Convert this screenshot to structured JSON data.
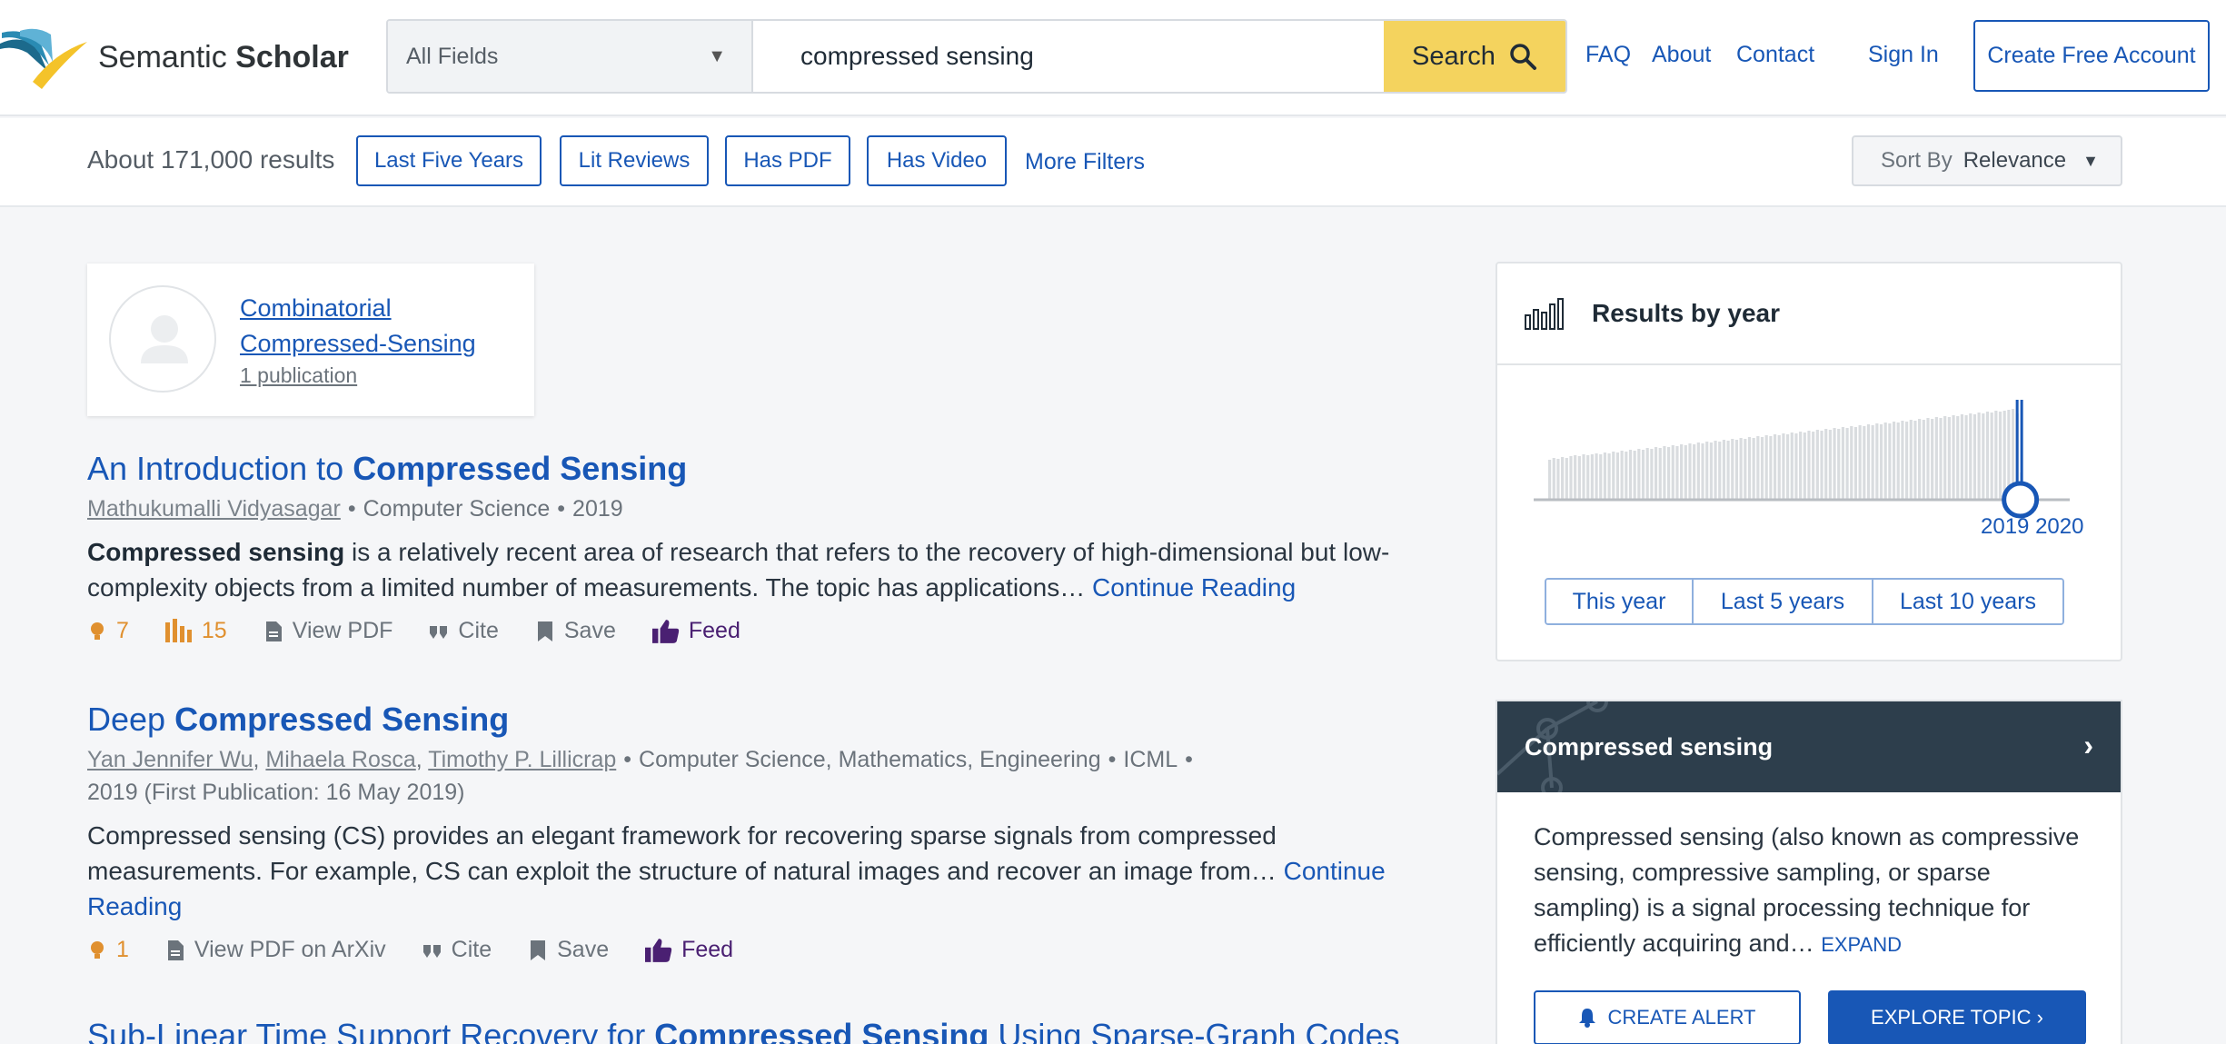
{
  "header": {
    "brand_word1": "Semantic",
    "brand_word2": "Scholar",
    "field_select": "All Fields",
    "query": "compressed sensing",
    "search_label": "Search",
    "nav": [
      "FAQ",
      "About",
      "Contact",
      "Sign In"
    ],
    "create_account": "Create Free Account"
  },
  "filters": {
    "result_count": "About 171,000 results",
    "chips": [
      "Last Five Years",
      "Lit Reviews",
      "Has PDF",
      "Has Video"
    ],
    "more_filters": "More Filters",
    "sort_label": "Sort By",
    "sort_value": "Relevance"
  },
  "author_card": {
    "name": "Combinatorial Compressed-Sensing",
    "publications": "1 publication"
  },
  "results": [
    {
      "title_plain": "An Introduction to ",
      "title_bold": "Compressed Sensing",
      "title_after": "",
      "authors": [
        "Mathukumalli Vidyasagar"
      ],
      "fields": "Computer Science",
      "venue": "",
      "year": "2019",
      "abstract_bold": "Compressed sensing",
      "abstract": " is a relatively recent area of research that refers to the recovery of high-dimensional but low-complexity objects from a limited number of measurements. The topic has applications…",
      "continue": "Continue Reading",
      "influential": "7",
      "citations": "15",
      "pdf_label": "View PDF",
      "cite": "Cite",
      "save": "Save",
      "feed": "Feed"
    },
    {
      "title_plain": "Deep ",
      "title_bold": "Compressed Sensing",
      "title_after": "",
      "authors": [
        "Yan Jennifer Wu",
        "Mihaela Rosca",
        "Timothy P. Lillicrap"
      ],
      "fields": "Computer Science, Mathematics, Engineering",
      "venue": "ICML",
      "year": "2019 (First Publication: 16 May 2019)",
      "abstract_bold": "",
      "abstract": "Compressed sensing (CS) provides an elegant framework for recovering sparse signals from compressed measurements. For example, CS can exploit the structure of natural images and recover an image from…",
      "continue": "Continue Reading",
      "influential": "1",
      "citations": "",
      "pdf_label": "View PDF on ArXiv",
      "cite": "Cite",
      "save": "Save",
      "feed": "Feed"
    },
    {
      "title_plain": "Sub-Linear Time Support Recovery for ",
      "title_bold": "Compressed Sensing",
      "title_after": " Using Sparse-Graph Codes"
    }
  ],
  "year_panel": {
    "title": "Results by year",
    "year_start_label": "2019",
    "year_end_label": "2020",
    "ranges": [
      "This year",
      "Last 5 years",
      "Last 10 years"
    ],
    "histogram_relative_counts": [
      0.44,
      0.46,
      0.45,
      0.47,
      0.46,
      0.48,
      0.49,
      0.48,
      0.5,
      0.49,
      0.5,
      0.51,
      0.5,
      0.52,
      0.51,
      0.53,
      0.52,
      0.54,
      0.53,
      0.55,
      0.54,
      0.56,
      0.55,
      0.57,
      0.56,
      0.58,
      0.57,
      0.59,
      0.58,
      0.6,
      0.59,
      0.61,
      0.6,
      0.62,
      0.61,
      0.63,
      0.62,
      0.64,
      0.63,
      0.65,
      0.64,
      0.66,
      0.65,
      0.67,
      0.66,
      0.68,
      0.67,
      0.69,
      0.68,
      0.7,
      0.69,
      0.71,
      0.7,
      0.72,
      0.71,
      0.73,
      0.72,
      0.74,
      0.73,
      0.75,
      0.74,
      0.76,
      0.75,
      0.77,
      0.76,
      0.78,
      0.77,
      0.79,
      0.78,
      0.8,
      0.79,
      0.81,
      0.8,
      0.82,
      0.81,
      0.83,
      0.82,
      0.84,
      0.83,
      0.85,
      0.84,
      0.86,
      0.85,
      0.87,
      0.86,
      0.88,
      0.87,
      0.89,
      0.88,
      0.9,
      0.89,
      0.91,
      0.9,
      0.92,
      0.91,
      0.93,
      0.92,
      0.94,
      0.93,
      0.95,
      0.94,
      0.96,
      0.95,
      0.97,
      0.96,
      0.98,
      0.97,
      0.98,
      0.99,
      1.0,
      0.95,
      0.3
    ],
    "histogram_color": "#d9dcdf",
    "selected_color": "#1857b6"
  },
  "topic_panel": {
    "title": "Compressed sensing",
    "description": "Compressed sensing (also known as compressive sensing, compressive sampling, or sparse sampling) is a signal processing technique for efficiently acquiring and…",
    "expand": "EXPAND",
    "create_alert": "CREATE ALERT",
    "explore": "EXPLORE TOPIC ›"
  },
  "colors": {
    "link_blue": "#1857b6",
    "search_yellow": "#f4d35e",
    "topic_header": "#2d3e4c",
    "influential_orange": "#e0902f",
    "feed_purple": "#4a2072"
  }
}
